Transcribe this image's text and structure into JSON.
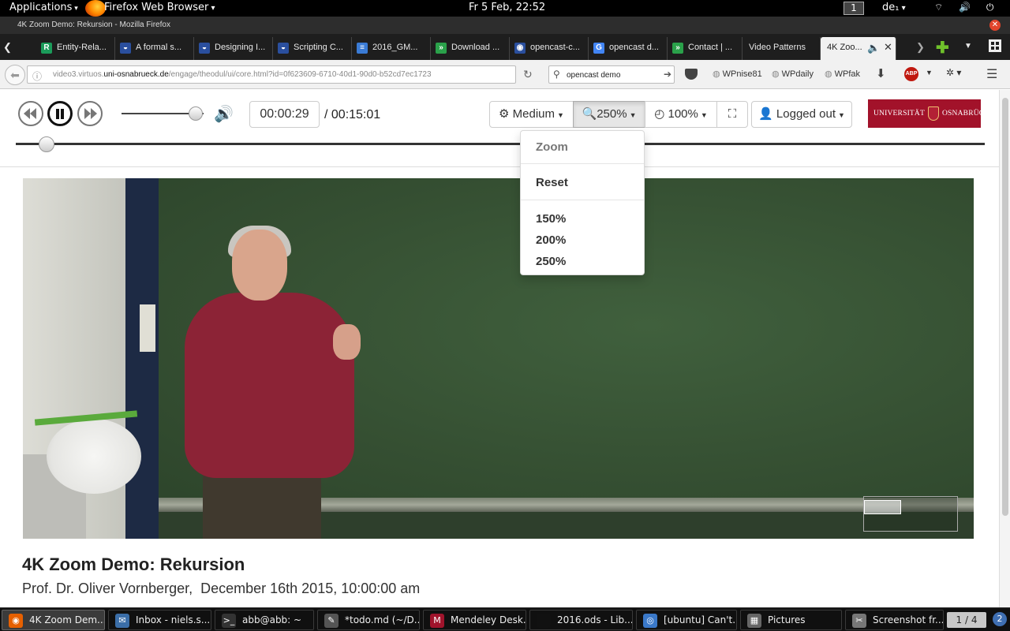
{
  "gnome": {
    "applications": "Applications",
    "app_name": "Firefox Web Browser",
    "clock": "Fr  5 Feb, 22:52",
    "workspace": "1",
    "lang": "de₁",
    "sys_icons": "⌔ 🔊 ⏻"
  },
  "window": {
    "title": "4K Zoom Demo: Rekursion - Mozilla Firefox",
    "close": "✕"
  },
  "tabs": [
    {
      "label": "Entity-Rela...",
      "icon": "R",
      "color": "#1b9b5a"
    },
    {
      "label": "A formal s...",
      "icon": "◒",
      "color": "#2a4f9e"
    },
    {
      "label": "Designing I...",
      "icon": "◒",
      "color": "#2a4f9e"
    },
    {
      "label": "Scripting C...",
      "icon": "◒",
      "color": "#2a4f9e"
    },
    {
      "label": "2016_GM...",
      "icon": "≡",
      "color": "#3a7bd5"
    },
    {
      "label": "Download ...",
      "icon": "»",
      "color": "#2aa14a"
    },
    {
      "label": "opencast-c...",
      "icon": "◉",
      "color": "#2a4f9e"
    },
    {
      "label": "opencast d...",
      "icon": "G",
      "color": "#4285f4"
    },
    {
      "label": "Contact | ...",
      "icon": "»",
      "color": "#2aa14a"
    },
    {
      "label": "Video Patterns",
      "icon": "",
      "color": "#1e1e1e"
    },
    {
      "label": "4K Zoo...",
      "icon": "",
      "color": "#f1f1f1"
    }
  ],
  "nav": {
    "url_prefix": "video3.virtuos.",
    "url_domain": "uni-osnabrueck.de",
    "url_path": "/engage/theodul/ui/core.html?id=0f623609-6710-40d1-90d0-b52cd7ec1723",
    "search_value": "opencast demo",
    "bookmarks": [
      "WPnise81",
      "WPdaily",
      "WPfak"
    ],
    "abp": "ABP"
  },
  "player": {
    "current_time": "00:00:29",
    "total_time": "/ 00:15:01",
    "quality_label": "Medium",
    "zoom_label": "250%",
    "speed_label": "100%",
    "login_label": "Logged out",
    "volume_level": 0.9,
    "seek_progress": 0.032,
    "logo_text_left": "UNIVERSITÄT",
    "logo_text_right": "OSNABRÜCK"
  },
  "zoom_menu": {
    "header": "Zoom",
    "reset": "Reset",
    "options": [
      "150%",
      "200%",
      "250%"
    ]
  },
  "video_info": {
    "title": "4K Zoom Demo: Rekursion",
    "presenter": "Prof. Dr. Oliver Vornberger,",
    "date": "December 16th 2015, 10:00:00 am"
  },
  "taskbar": {
    "items": [
      {
        "label": "4K Zoom Dem...",
        "icon": "◉",
        "color": "#e66000"
      },
      {
        "label": "Inbox - niels.s...",
        "icon": "✉",
        "color": "#3b6ea8"
      },
      {
        "label": "abb@abb: ~",
        "icon": ">_",
        "color": "#333"
      },
      {
        "label": "*todo.md (~/D...",
        "icon": "✎",
        "color": "#555"
      },
      {
        "label": "Mendeley Desk...",
        "icon": "M",
        "color": "#a0142c"
      },
      {
        "label": "2016.ods - Lib...",
        "icon": "",
        "color": "#111"
      },
      {
        "label": "[ubuntu] Can't...",
        "icon": "◎",
        "color": "#3a78c8"
      },
      {
        "label": "Pictures",
        "icon": "▦",
        "color": "#666"
      },
      {
        "label": "Screenshot fr...",
        "icon": "✂",
        "color": "#777"
      }
    ],
    "pager": "1 / 4",
    "notifications": "2"
  }
}
